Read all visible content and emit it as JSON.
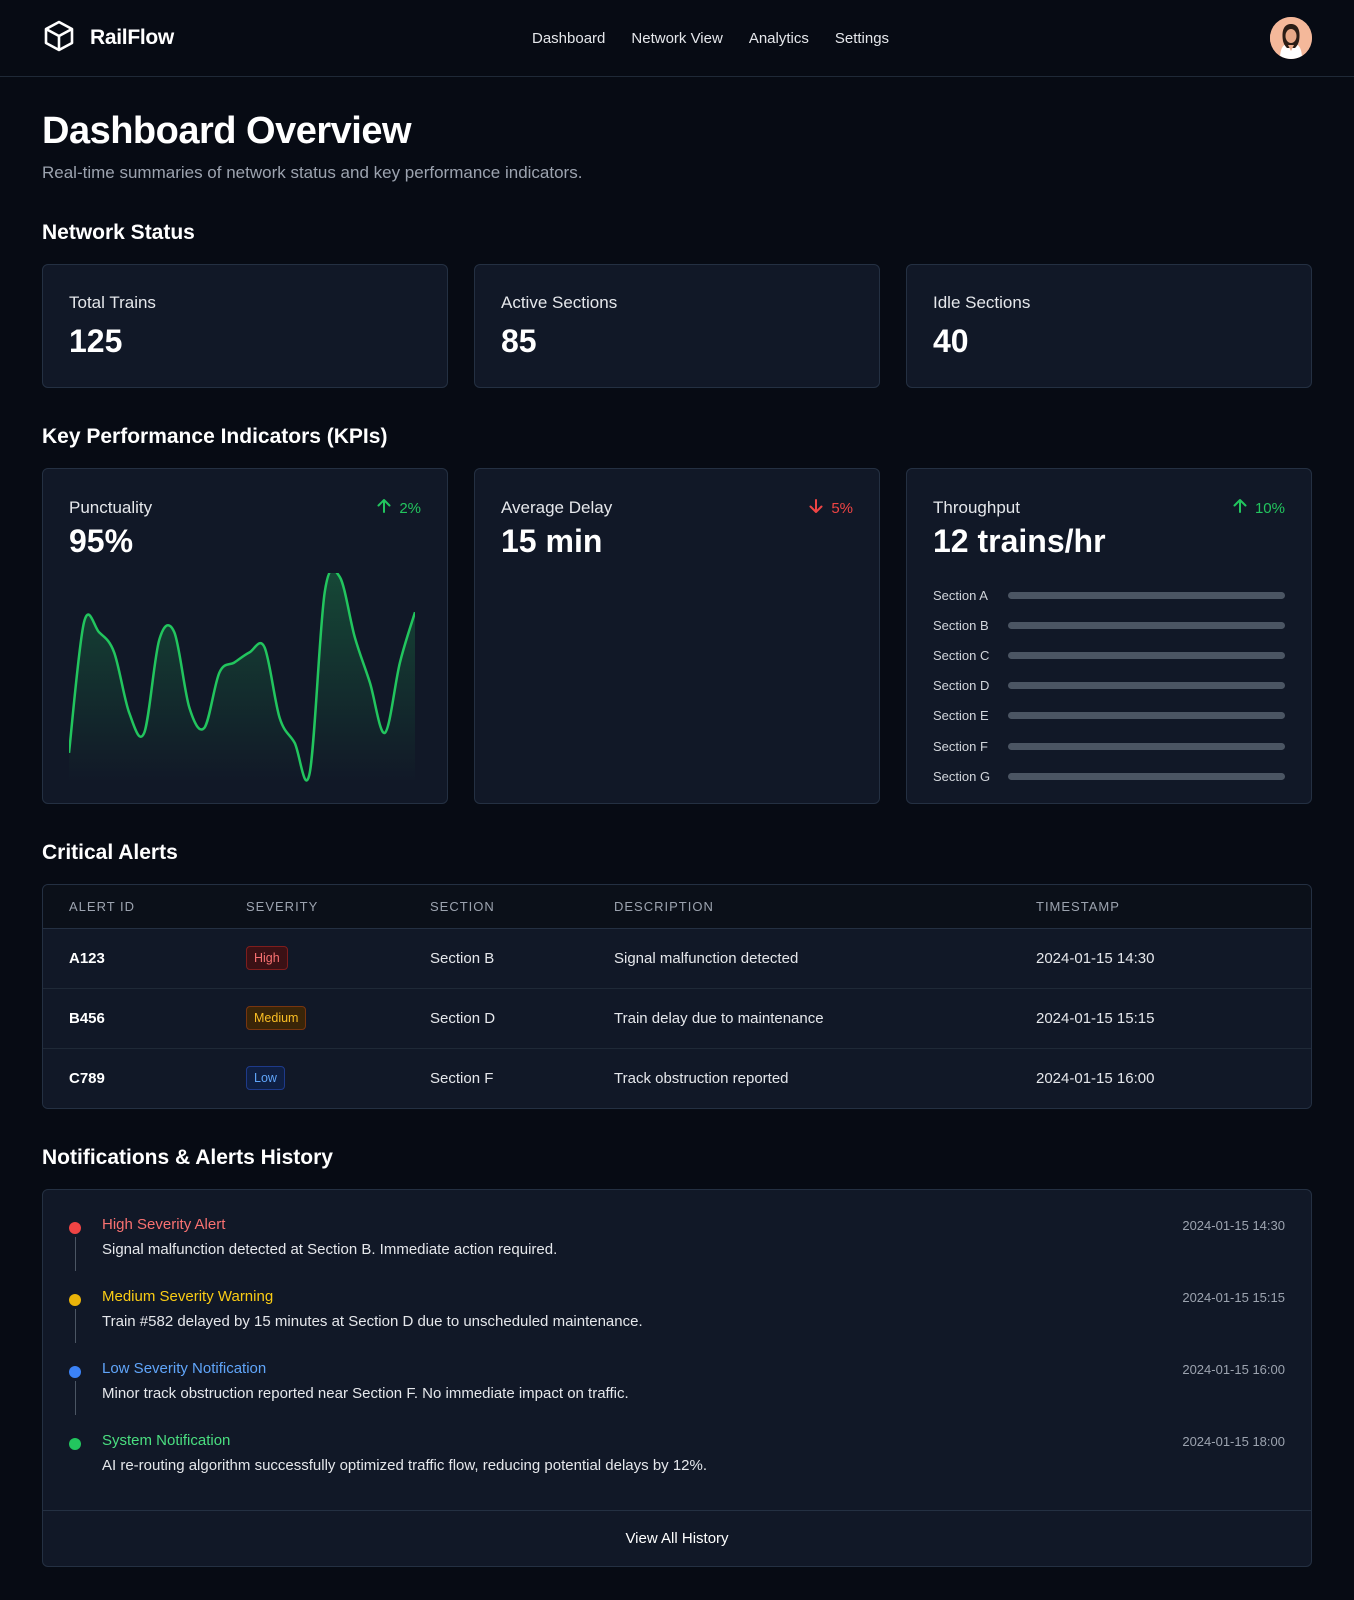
{
  "header": {
    "brand": "RailFlow",
    "nav": [
      "Dashboard",
      "Network View",
      "Analytics",
      "Settings"
    ]
  },
  "page": {
    "title": "Dashboard Overview",
    "subtitle": "Real-time summaries of network status and key performance indicators."
  },
  "network_status": {
    "title": "Network Status",
    "cards": [
      {
        "label": "Total Trains",
        "value": "125"
      },
      {
        "label": "Active Sections",
        "value": "85"
      },
      {
        "label": "Idle Sections",
        "value": "40"
      }
    ]
  },
  "kpis": {
    "title": "Key Performance Indicators (KPIs)",
    "punctuality": {
      "label": "Punctuality",
      "value": "95%",
      "change": "2%",
      "direction": "up",
      "color": "#22c55e"
    },
    "delay": {
      "label": "Average Delay",
      "value": "15 min",
      "change": "5%",
      "direction": "down",
      "color": "#ef4444"
    },
    "throughput": {
      "label": "Throughput",
      "value": "12 trains/hr",
      "change": "10%",
      "direction": "up",
      "color": "#22c55e",
      "sections": [
        "Section A",
        "Section B",
        "Section C",
        "Section D",
        "Section E",
        "Section F",
        "Section G"
      ]
    }
  },
  "chart_data": {
    "type": "area",
    "series": [
      {
        "values": [
          10,
          62,
          58,
          50,
          26,
          18,
          55,
          58,
          28,
          20,
          42,
          46,
          50,
          52,
          24,
          14,
          2,
          74,
          80,
          56,
          38,
          18,
          46,
          66
        ]
      }
    ],
    "color": "#22c55e"
  },
  "alerts": {
    "title": "Critical Alerts",
    "columns": [
      "ALERT ID",
      "SEVERITY",
      "SECTION",
      "DESCRIPTION",
      "TIMESTAMP"
    ],
    "rows": [
      {
        "id": "A123",
        "severity": "High",
        "level": "high",
        "section": "Section B",
        "description": "Signal malfunction detected",
        "timestamp": "2024-01-15 14:30"
      },
      {
        "id": "B456",
        "severity": "Medium",
        "level": "medium",
        "section": "Section D",
        "description": "Train delay due to maintenance",
        "timestamp": "2024-01-15 15:15"
      },
      {
        "id": "C789",
        "severity": "Low",
        "level": "low",
        "section": "Section F",
        "description": "Track obstruction reported",
        "timestamp": "2024-01-15 16:00"
      }
    ]
  },
  "history": {
    "title": "Notifications & Alerts History",
    "items": [
      {
        "title": "High Severity Alert",
        "desc": "Signal malfunction detected at Section B. Immediate action required.",
        "time": "2024-01-15 14:30",
        "color": "#ef4444",
        "text_color": "#f87171"
      },
      {
        "title": "Medium Severity Warning",
        "desc": "Train #582 delayed by 15 minutes at Section D due to unscheduled maintenance.",
        "time": "2024-01-15 15:15",
        "color": "#eab308",
        "text_color": "#facc15"
      },
      {
        "title": "Low Severity Notification",
        "desc": "Minor track obstruction reported near Section F. No immediate impact on traffic.",
        "time": "2024-01-15 16:00",
        "color": "#3b82f6",
        "text_color": "#60a5fa"
      },
      {
        "title": "System Notification",
        "desc": "AI re-routing algorithm successfully optimized traffic flow, reducing potential delays by 12%.",
        "time": "2024-01-15 18:00",
        "color": "#22c55e",
        "text_color": "#4ade80"
      }
    ],
    "view_all": "View All History"
  }
}
